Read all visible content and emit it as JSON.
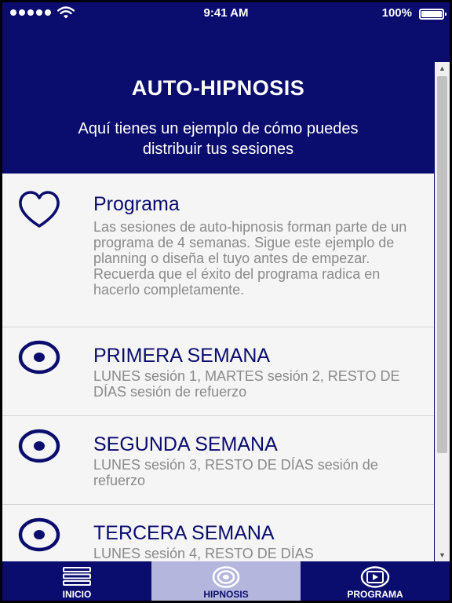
{
  "status_bar": {
    "time": "9:41 AM",
    "battery": "100%"
  },
  "header": {
    "title": "AUTO-HIPNOSIS",
    "subtitle": "Aquí tienes un ejemplo de cómo puedes distribuir tus sesiones"
  },
  "items": [
    {
      "icon": "heart-icon",
      "title": "Programa",
      "description": "Las sesiones de auto-hipnosis forman parte de un programa de 4 semanas. Sigue este ejemplo de planning o diseña el tuyo antes de empezar. Recuerda que el éxito del programa radica en hacerlo completamente."
    },
    {
      "icon": "target-icon",
      "title": "PRIMERA SEMANA",
      "description": "LUNES sesión 1, MARTES sesión 2, RESTO DE DÍAS sesión de refuerzo"
    },
    {
      "icon": "target-icon",
      "title": "SEGUNDA SEMANA",
      "description": "LUNES sesión 3, RESTO DE DÍAS sesión de refuerzo"
    },
    {
      "icon": "target-icon",
      "title": "TERCERA SEMANA",
      "description": "LUNES sesión 4, RESTO DE DÍAS"
    }
  ],
  "tabs": [
    {
      "label": "INICIO",
      "icon": "menu-icon",
      "active": false
    },
    {
      "label": "HIPNOSIS",
      "icon": "hypnosis-icon",
      "active": true
    },
    {
      "label": "PROGRAMA",
      "icon": "video-icon",
      "active": false
    }
  ],
  "colors": {
    "primary": "#0a0d6e",
    "active_tab": "#b4b6dd",
    "text_muted": "#8a8a8a",
    "background": "#f5f5f5"
  }
}
